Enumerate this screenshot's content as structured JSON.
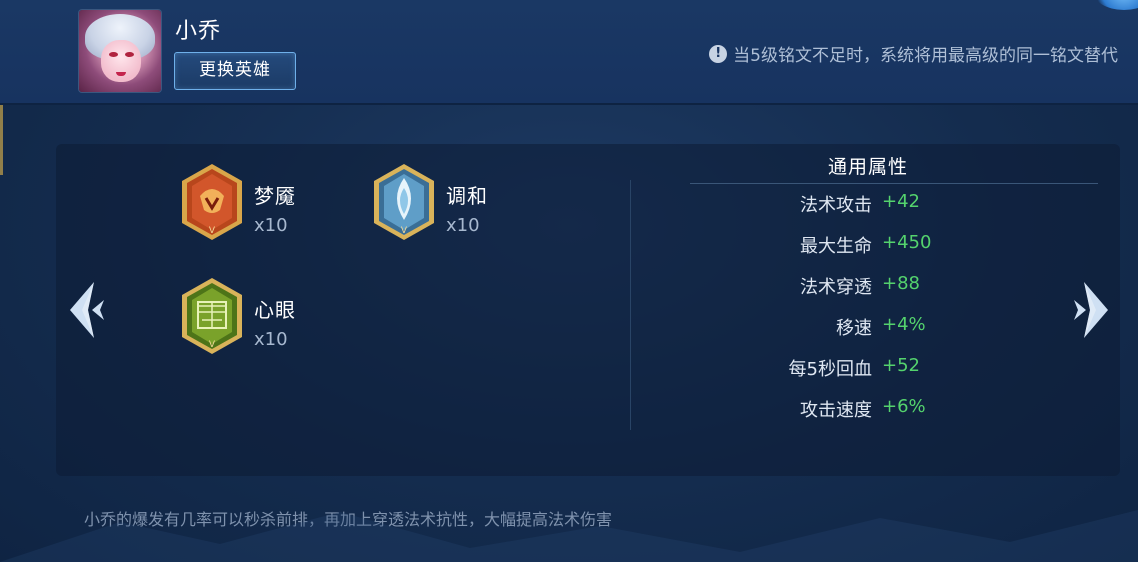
{
  "hero": {
    "name": "小乔",
    "change_button": "更换英雄"
  },
  "notice": {
    "icon": "exclamation-icon",
    "text": "当5级铭文不足时，系统将用最高级的同一铭文替代"
  },
  "inscriptions": [
    {
      "name": "梦魇",
      "count": "x10",
      "color": "#d2562b",
      "icon": "red-inscription-icon"
    },
    {
      "name": "调和",
      "count": "x10",
      "color": "#8fc7e8",
      "icon": "blue-inscription-icon"
    },
    {
      "name": "心眼",
      "count": "x10",
      "color": "#7aa22a",
      "icon": "green-inscription-icon"
    }
  ],
  "attributes": {
    "title": "通用属性",
    "items": [
      {
        "name": "法术攻击",
        "value": "+42"
      },
      {
        "name": "最大生命",
        "value": "+450"
      },
      {
        "name": "法术穿透",
        "value": "+88"
      },
      {
        "name": "移速",
        "value": "+4%"
      },
      {
        "name": "每5秒回血",
        "value": "+52"
      },
      {
        "name": "攻击速度",
        "value": "+6%"
      }
    ]
  },
  "description": "小乔的爆发有几率可以秒杀前排，再加上穿透法术抗性，大幅提高法术伤害",
  "colors": {
    "accent": "#6fb0ea",
    "positive": "#54d36d",
    "background": "#142c4e"
  }
}
